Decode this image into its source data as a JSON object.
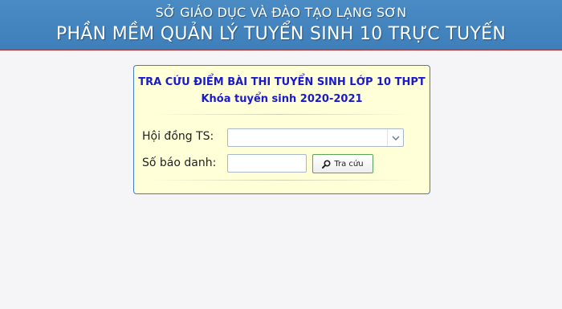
{
  "header": {
    "org": "SỞ GIÁO DỤC VÀ ĐÀO TẠO LẠNG SƠN",
    "title": "PHẦN MỀM QUẢN LÝ TUYỂN SINH 10 TRỰC TUYẾN"
  },
  "panel": {
    "title": "TRA CỨU ĐIỂM BÀI THI TUYỂN SINH LỚP 10 THPT",
    "subtitle": "Khóa tuyển sinh 2020-2021",
    "fields": {
      "council_label": "Hội đồng TS:",
      "council_value": "",
      "sbd_label": "Số báo danh:",
      "sbd_value": ""
    },
    "search_button": "Tra cứu",
    "icons": {
      "dropdown": "chevron-down-icon",
      "search": "search-icon"
    }
  },
  "colors": {
    "header_bg": "#4a8bc4",
    "header_border": "#b84848",
    "panel_bg": "#ffffd8",
    "title_text": "#1a1acc",
    "button_border": "#5aa55a"
  }
}
